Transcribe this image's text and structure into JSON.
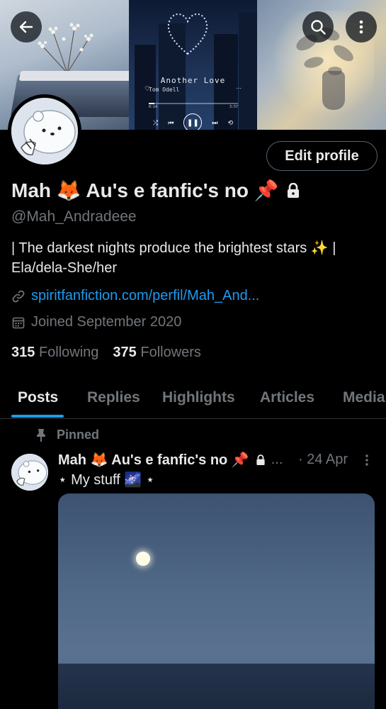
{
  "banner": {
    "music_title": "Another Love",
    "music_artist": "Tom Odell",
    "time_elapsed": "0:14",
    "time_total": "3:57",
    "progress": 0.06
  },
  "header": {
    "back_icon": "arrow-left-icon",
    "search_icon": "search-icon",
    "more_icon": "more-vertical-icon"
  },
  "profile": {
    "edit_label": "Edit profile",
    "display_name": "Mah 🦊 Au's e fanfic's no 📌",
    "handle": "@Mah_Andradeee",
    "bio_line1": "| The darkest nights produce the brightest stars ✨ |",
    "bio_line2": "Ela/dela-She/her",
    "link": "spiritfanfiction.com/perfil/Mah_And...",
    "joined": "Joined September 2020",
    "following_count": "315",
    "following_label": "Following",
    "followers_count": "375",
    "followers_label": "Followers"
  },
  "tabs": [
    "Posts",
    "Replies",
    "Highlights",
    "Articles",
    "Media"
  ],
  "post": {
    "pinned_label": "Pinned",
    "author": "Mah 🦊 Au's e fanfic's no 📌",
    "ellipsis": "...",
    "date": "· 24 Apr",
    "text": "⋆ My stuff 🌌 ⋆"
  },
  "colors": {
    "background": "#000000",
    "accent": "#1d9bf0",
    "secondary_text": "#71767b",
    "primary_text": "#e7e9ea"
  }
}
